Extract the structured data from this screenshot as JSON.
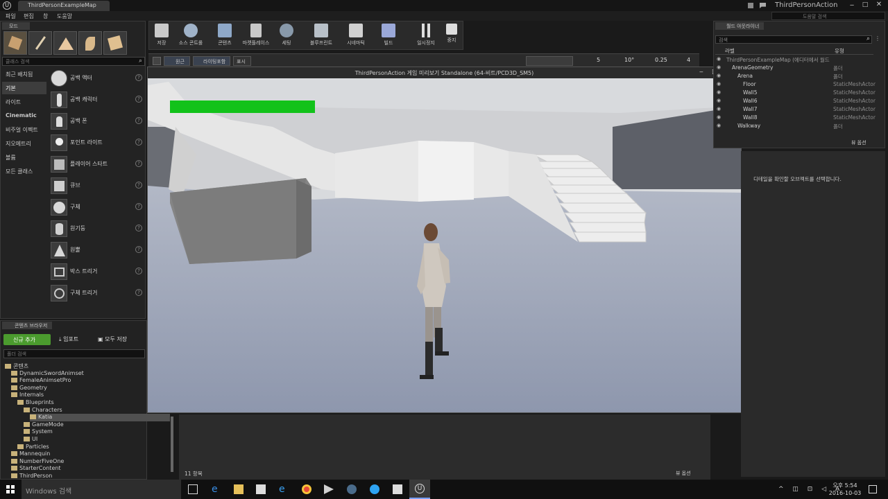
{
  "app": {
    "tab_title": "ThirdPersonExampleMap",
    "project_name": "ThirdPersonAction",
    "help_search_placeholder": "도움말 검색"
  },
  "menu": [
    "파일",
    "편집",
    "창",
    "도움말"
  ],
  "modes": {
    "title": "모드",
    "search_placeholder": "클래스 검색",
    "categories": [
      "최근 배치됨",
      "기본",
      "라이트",
      "Cinematic",
      "비주얼 이펙트",
      "지오메트리",
      "볼륨",
      "모든 클래스"
    ],
    "active_category_index": 1,
    "actors": [
      {
        "label": "공백 액터"
      },
      {
        "label": "공백 캐릭터"
      },
      {
        "label": "공백 폰"
      },
      {
        "label": "포인트 라이트"
      },
      {
        "label": "플레이어 스타트"
      },
      {
        "label": "큐브"
      },
      {
        "label": "구체"
      },
      {
        "label": "원기둥"
      },
      {
        "label": "원뿔"
      },
      {
        "label": "박스 트리거"
      },
      {
        "label": "구체 트리거"
      }
    ]
  },
  "toolbar": {
    "buttons": [
      {
        "label": "저장",
        "icon": "save-icon"
      },
      {
        "label": "소스 콘트롤",
        "icon": "source-control-icon"
      },
      {
        "label": "콘텐츠",
        "icon": "content-icon"
      },
      {
        "label": "마켓플레이스",
        "icon": "marketplace-icon"
      },
      {
        "label": "세팅",
        "icon": "settings-icon"
      },
      {
        "label": "블루프린트",
        "icon": "blueprint-icon"
      },
      {
        "label": "시네마틱",
        "icon": "cinematic-icon"
      },
      {
        "label": "빌드",
        "icon": "build-icon"
      },
      {
        "label": "일시정지",
        "icon": "pause-icon"
      },
      {
        "label": "중지",
        "icon": "stop-icon"
      }
    ]
  },
  "viewport_bar": {
    "perspective": "원근",
    "lighting": "라이팅포함",
    "show": "표시",
    "grid_snap": "5",
    "rotation_snap": "10°",
    "scale_snap": "0.25",
    "camera_speed": "4"
  },
  "game_window": {
    "title": "ThirdPersonAction 게임 미리보기 Standalone (64-비트/PCD3D_SM5)",
    "health": 0.55
  },
  "outliner": {
    "title": "월드 아웃라이너",
    "search_placeholder": "검색",
    "col_label": "라벨",
    "col_type": "유형",
    "rows": [
      {
        "name": "ThirdPersonExampleMap (에디터에서 월드",
        "type": "",
        "indent": 0
      },
      {
        "name": "ArenaGeometry",
        "type": "폴더",
        "indent": 1
      },
      {
        "name": "Arena",
        "type": "폴더",
        "indent": 2
      },
      {
        "name": "Floor",
        "type": "StaticMeshActor",
        "indent": 3
      },
      {
        "name": "Wall5",
        "type": "StaticMeshActor",
        "indent": 3
      },
      {
        "name": "Wall6",
        "type": "StaticMeshActor",
        "indent": 3
      },
      {
        "name": "Wall7",
        "type": "StaticMeshActor",
        "indent": 3
      },
      {
        "name": "Wall8",
        "type": "StaticMeshActor",
        "indent": 3
      },
      {
        "name": "Walkway",
        "type": "폴더",
        "indent": 2
      }
    ],
    "view_options": "뷰 옵션"
  },
  "details": {
    "hint": "디테일을 확인할 오브젝트를 선택합니다."
  },
  "content_browser": {
    "title": "콘텐츠 브라우저",
    "add_new": "신규 추가",
    "import": "임포트",
    "save_all": "모두 저장",
    "folder_search": "폴더 검색",
    "tree": [
      {
        "label": "콘텐츠",
        "indent": 0
      },
      {
        "label": "DynamicSwordAnimset",
        "indent": 1
      },
      {
        "label": "FemaleAnimsetPro",
        "indent": 1
      },
      {
        "label": "Geometry",
        "indent": 1
      },
      {
        "label": "Internals",
        "indent": 1
      },
      {
        "label": "Blueprints",
        "indent": 2
      },
      {
        "label": "Characters",
        "indent": 3
      },
      {
        "label": "Katia",
        "indent": 4
      },
      {
        "label": "GameMode",
        "indent": 3
      },
      {
        "label": "System",
        "indent": 3
      },
      {
        "label": "UI",
        "indent": 3
      },
      {
        "label": "Particles",
        "indent": 2
      },
      {
        "label": "Mannequin",
        "indent": 1
      },
      {
        "label": "NumberFiveOne",
        "indent": 1
      },
      {
        "label": "StarterContent",
        "indent": 1
      },
      {
        "label": "ThirdPerson",
        "indent": 1
      }
    ],
    "item_count": "11 항목",
    "view_options": "뷰 옵션"
  },
  "taskbar": {
    "search_placeholder": "Windows 검색",
    "time": "오후 5:54",
    "date": "2016-10-03"
  }
}
